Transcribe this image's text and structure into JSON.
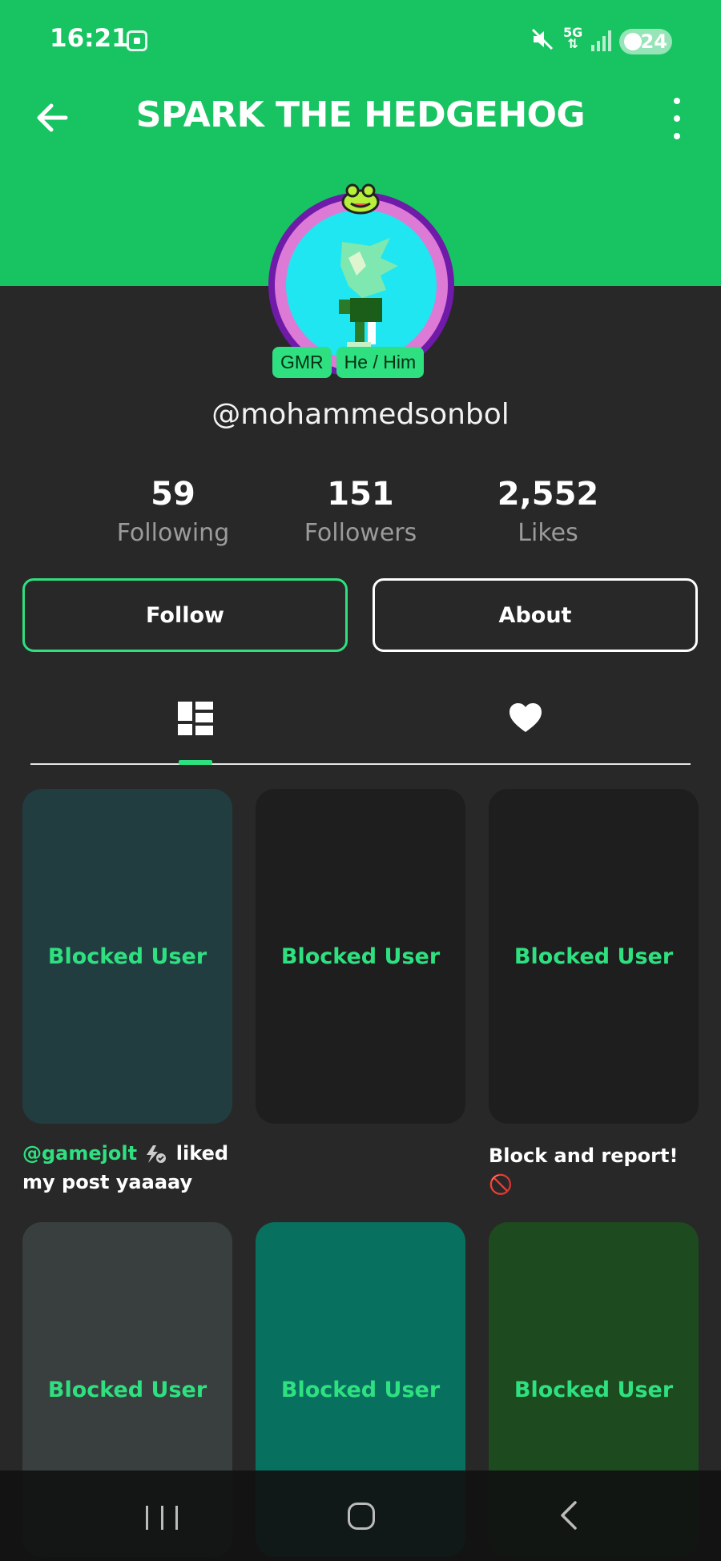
{
  "status_bar": {
    "time": "16:21",
    "network": "5G",
    "battery": "24"
  },
  "header": {
    "title": "SPARK THE HEDGEHOG"
  },
  "profile": {
    "badges": [
      "GMR",
      "He / Him"
    ],
    "username": "@mohammedsonbol",
    "stats": [
      {
        "value": "59",
        "label": "Following"
      },
      {
        "value": "151",
        "label": "Followers"
      },
      {
        "value": "2,552",
        "label": "Likes"
      }
    ],
    "follow_label": "Follow",
    "about_label": "About"
  },
  "tabs": {
    "active": "posts",
    "icons": [
      "posts-grid-icon",
      "heart-icon"
    ]
  },
  "posts": [
    {
      "label": "Blocked User",
      "color": "#213d40"
    },
    {
      "label": "Blocked User",
      "color": "#1d1e1d"
    },
    {
      "label": "Blocked User",
      "color": "#1d1e1d"
    },
    {
      "label": "Blocked User",
      "color": "#393f3f"
    },
    {
      "label": "Blocked User",
      "color": "#08705f"
    },
    {
      "label": "Blocked User",
      "color": "#1e4a1f"
    }
  ],
  "captions": {
    "first_mention": "@gamejolt",
    "first_rest": " liked",
    "first_line2": "my post yaaaay",
    "third": "Block and report!🚫"
  },
  "theme": {
    "accent": "#2ee07f",
    "header": "#17c461",
    "background": "#282828"
  }
}
